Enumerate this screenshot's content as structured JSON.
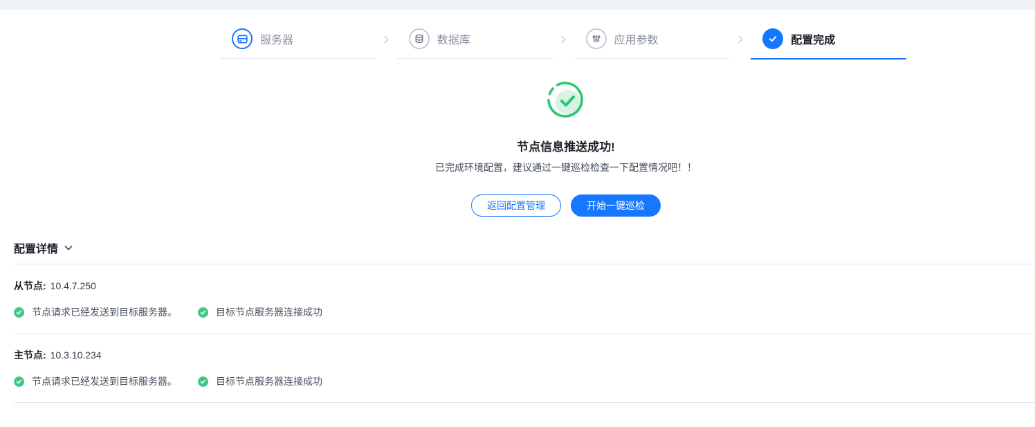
{
  "stepper": {
    "separator": "›",
    "steps": [
      {
        "label": "服务器",
        "icon": "server-icon",
        "state": "done"
      },
      {
        "label": "数据库",
        "icon": "database-icon",
        "state": "pending"
      },
      {
        "label": "应用参数",
        "icon": "sliders-icon",
        "state": "pending"
      },
      {
        "label": "配置完成",
        "icon": "check-icon",
        "state": "active"
      }
    ]
  },
  "result": {
    "title": "节点信息推送成功!",
    "subtitle": "已完成环境配置，建议通过一键巡检检查一下配置情况吧！！",
    "back_button": "返回配置管理",
    "inspect_button": "开始一键巡检"
  },
  "details": {
    "header": "配置详情",
    "nodes": [
      {
        "label": "从节点:",
        "ip": "10.4.7.250",
        "checks": [
          "节点请求已经发送到目标服务器。",
          "目标节点服务器连接成功"
        ]
      },
      {
        "label": "主节点:",
        "ip": "10.3.10.234",
        "checks": [
          "节点请求已经发送到目标服务器。",
          "目标节点服务器连接成功"
        ]
      }
    ]
  },
  "colors": {
    "accent_blue": "#1677ff",
    "success_green": "#2bc76e",
    "success_light_green": "#d8f3e4",
    "badge_green": "#43c789",
    "topbar_gray": "#eff2f7",
    "divider_gray": "#e5e6eb"
  }
}
